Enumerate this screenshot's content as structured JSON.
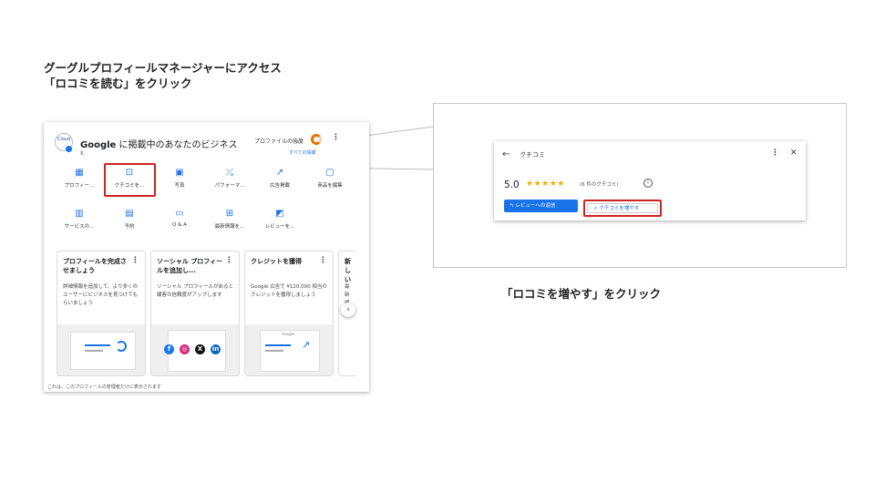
{
  "instructions": {
    "line1": "グーグルプロフィールマネージャーにアクセス",
    "line2": "「ロコミを読む」をクリック",
    "line3": "「ロコミを増やす」をクリック"
  },
  "profile_panel": {
    "logo_text": "Cloud",
    "title_brand": "Google",
    "title_rest": " に掲載中のあなたのビジネス",
    "subtitle": "札",
    "strength_label": "プロファイルの強度",
    "see_all": "すべての情報",
    "actions_row1": [
      {
        "icon": "storefront-icon",
        "glyph": "▦",
        "label": "プロフィー..."
      },
      {
        "icon": "review-icon",
        "glyph": "⊡",
        "label": "クチコミを..."
      },
      {
        "icon": "photo-icon",
        "glyph": "▣",
        "label": "写真"
      },
      {
        "icon": "performance-icon",
        "glyph": "⤯",
        "label": "パフォーマ..."
      },
      {
        "icon": "ads-icon",
        "glyph": "↗",
        "label": "広告掲載"
      },
      {
        "icon": "products-icon",
        "glyph": "▢",
        "label": "商品を編集"
      }
    ],
    "actions_row2": [
      {
        "icon": "services-icon",
        "glyph": "▥",
        "label": "サービスの..."
      },
      {
        "icon": "calendar-icon",
        "glyph": "▤",
        "label": "予約"
      },
      {
        "icon": "qa-icon",
        "glyph": "▭",
        "label": "Q & A"
      },
      {
        "icon": "post-icon",
        "glyph": "⊞",
        "label": "最新情報を..."
      },
      {
        "icon": "review-request-icon",
        "glyph": "◩",
        "label": "レビューを..."
      }
    ],
    "cards": [
      {
        "title": "プロフィールを完成させましょう",
        "body": "詳細情報を追加して、より多くのユーザーにビジネスを見つけてもらいましょう"
      },
      {
        "title": "ソーシャル プロフィールを追加し...",
        "body": "ソーシャル プロフィールがあると顧客の信頼度がアップします"
      },
      {
        "title": "クレジットを獲得",
        "body": "Google 広告で ¥120,000 相当のクレジットを獲得しましょう"
      },
      {
        "title": "新しい",
        "body": "最新顧"
      }
    ],
    "ad_preview_text": "Google",
    "footer": "これは、このプロフィールの管理者だけに表示されます"
  },
  "review_panel": {
    "title": "クチコミ",
    "score": "5.0",
    "stars": "★★★★★",
    "count": "(6 件のクチコミ)",
    "reply_button": "レビューへの返信",
    "grow_button": "クチコミを増やす"
  },
  "colors": {
    "accent": "#1a73e8",
    "highlight": "#d0221f",
    "star": "#f9ab00",
    "strength": "#e37400"
  }
}
